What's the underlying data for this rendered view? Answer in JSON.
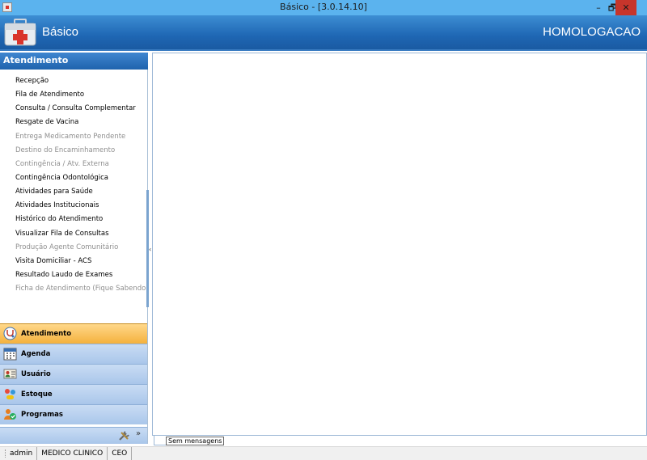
{
  "window": {
    "title": "Básico - [3.0.14.10]",
    "controls": {
      "minimize": "–",
      "restore": "🗗",
      "close": "✕"
    }
  },
  "header": {
    "app_name": "Básico",
    "environment": "HOMOLOGACAO",
    "icon": "first-aid-kit-icon"
  },
  "sidebar": {
    "section_title": "Atendimento",
    "items": [
      {
        "label": "Recepção",
        "enabled": true
      },
      {
        "label": "Fila de Atendimento",
        "enabled": true
      },
      {
        "label": "Consulta / Consulta Complementar",
        "enabled": true
      },
      {
        "label": "Resgate de Vacina",
        "enabled": true
      },
      {
        "label": "Entrega Medicamento Pendente",
        "enabled": false
      },
      {
        "label": "Destino do Encaminhamento",
        "enabled": false
      },
      {
        "label": "Contingência / Atv. Externa",
        "enabled": false
      },
      {
        "label": "Contingência Odontológica",
        "enabled": true
      },
      {
        "label": "Atividades para Saúde",
        "enabled": true
      },
      {
        "label": "Atividades Institucionais",
        "enabled": true
      },
      {
        "label": "Histórico do Atendimento",
        "enabled": true
      },
      {
        "label": "Visualizar Fila de Consultas",
        "enabled": true
      },
      {
        "label": "Produção Agente Comunitário",
        "enabled": false
      },
      {
        "label": "Visita Domiciliar - ACS",
        "enabled": true
      },
      {
        "label": "Resultado Laudo de Exames",
        "enabled": true
      },
      {
        "label": "Ficha de Atendimento (Fique Sabendo)",
        "enabled": false
      }
    ],
    "splitter": "........",
    "nav": [
      {
        "label": "Atendimento",
        "icon": "stethoscope-icon",
        "active": true
      },
      {
        "label": "Agenda",
        "icon": "calendar-icon",
        "active": false
      },
      {
        "label": "Usuário",
        "icon": "user-card-icon",
        "active": false
      },
      {
        "label": "Estoque",
        "icon": "stock-pills-icon",
        "active": false
      },
      {
        "label": "Programas",
        "icon": "programs-people-icon",
        "active": false
      }
    ],
    "footer": {
      "tools_icon": "tools-icon",
      "expand": "»"
    },
    "collapse_arrow": "‹"
  },
  "content": {
    "message_label": "Sem mensagens"
  },
  "statusbar": {
    "user": "admin",
    "role": "MEDICO CLINICO",
    "unit": "CEO"
  },
  "colors": {
    "titlebar": "#5bb3ee",
    "header": "#1f67b4",
    "close_button": "#c7352b",
    "active_nav": "#f4b13d",
    "nav": "#b9d1ef",
    "disabled_text": "#8f8f8f"
  }
}
